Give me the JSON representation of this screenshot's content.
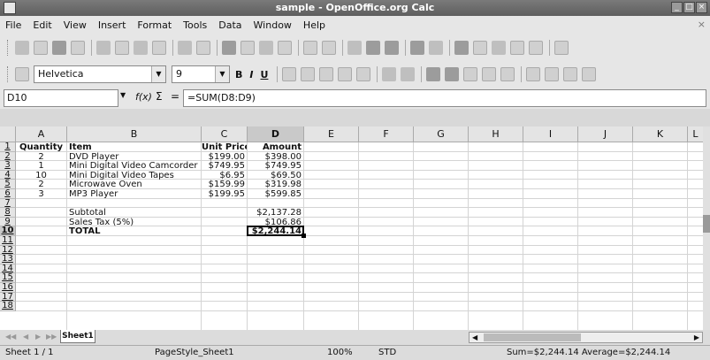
{
  "window": {
    "title": "sample - OpenOffice.org Calc"
  },
  "menu": [
    "File",
    "Edit",
    "View",
    "Insert",
    "Format",
    "Tools",
    "Data",
    "Window",
    "Help"
  ],
  "format_bar": {
    "font_name": "Helvetica",
    "font_size": "9"
  },
  "formula_bar": {
    "cell_ref": "D10",
    "formula": "=SUM(D8:D9)",
    "fx": "f(x)",
    "sum": "Σ",
    "equals": "="
  },
  "columns": [
    "A",
    "B",
    "C",
    "D",
    "E",
    "F",
    "G",
    "H",
    "I",
    "J",
    "K",
    "L"
  ],
  "rows": [
    "1",
    "2",
    "3",
    "4",
    "5",
    "6",
    "7",
    "8",
    "9",
    "10",
    "11",
    "12",
    "13",
    "14",
    "15",
    "16",
    "17",
    "18"
  ],
  "cells": {
    "A1": "Quantity",
    "B1": "Item",
    "C1": "Unit Price",
    "D1": "Amount",
    "A2": "2",
    "B2": "DVD Player",
    "C2": "$199.00",
    "D2": "$398.00",
    "A3": "1",
    "B3": "Mini Digital Video Camcorder",
    "C3": "$749.95",
    "D3": "$749.95",
    "A4": "10",
    "B4": "Mini Digital Video Tapes",
    "C4": "$6.95",
    "D4": "$69.50",
    "A5": "2",
    "B5": "Microwave Oven",
    "C5": "$159.99",
    "D5": "$319.98",
    "A6": "3",
    "B6": "MP3 Player",
    "C6": "$199.95",
    "D6": "$599.85",
    "B8": "Subtotal",
    "D8": "$2,137.28",
    "B9": "Sales Tax (5%)",
    "D9": "$106.86",
    "B10": "TOTAL",
    "D10": "$2,244.14"
  },
  "sheet_tab": "Sheet1",
  "status": {
    "sheet": "Sheet 1 / 1",
    "page_style": "PageStyle_Sheet1",
    "zoom": "100%",
    "mode": "STD",
    "summary": "Sum=$2,244.14 Average=$2,244.14"
  }
}
